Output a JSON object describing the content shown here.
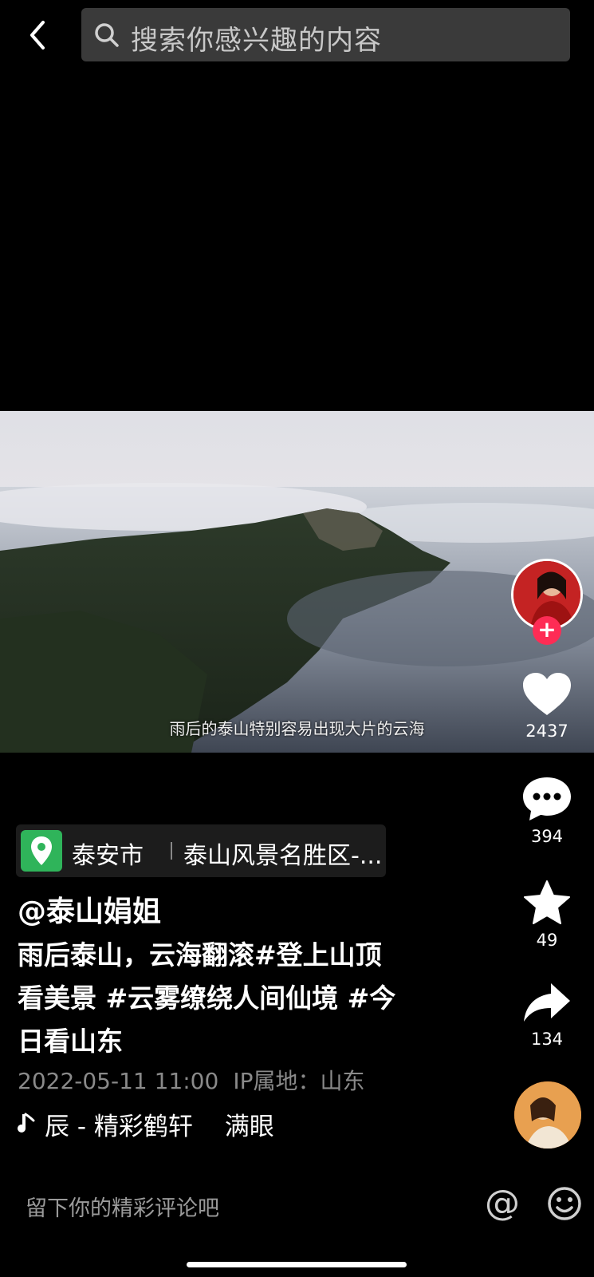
{
  "search": {
    "placeholder": "搜索你感兴趣的内容"
  },
  "video": {
    "subtitle": "雨后的泰山特别容易出现大片的云海"
  },
  "actions": {
    "likes": "2437",
    "comments": "394",
    "favorites": "49",
    "shares": "134"
  },
  "location": {
    "city": "泰安市",
    "place": "泰山风景名胜区-..."
  },
  "post": {
    "author": "@泰山娟姐",
    "caption_lines": [
      "雨后泰山，云海翻滚#登上山顶",
      "看美景 #云雾缭绕人间仙境 #今",
      "日看山东"
    ],
    "datetime": "2022-05-11 11:00",
    "ip": "IP属地：山东"
  },
  "music": {
    "title": "辰 - 精彩鹤轩",
    "artist": "满眼"
  },
  "comment": {
    "placeholder": "留下你的精彩评论吧",
    "at_symbol": "@"
  },
  "colors": {
    "follow": "#fe2c55",
    "location_pin": "#2fb45a"
  }
}
